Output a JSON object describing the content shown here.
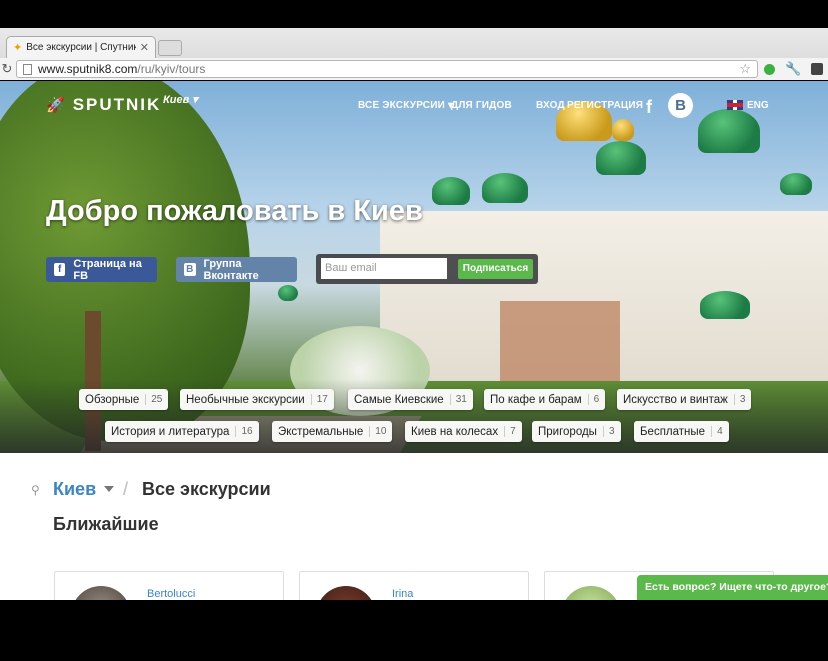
{
  "browser": {
    "tab_title": "Все экскурсии | Спутник",
    "url_host": "www.sputnik8.com",
    "url_path": "/ru/kyiv/tours"
  },
  "header": {
    "logo": "SPUTNIK",
    "city": "Киев ▾",
    "nav_all_tours": "ВСЕ ЭКСКУРСИИ ▾",
    "nav_for_guides": "ДЛЯ ГИДОВ",
    "nav_login": "ВХОД",
    "nav_register": "РЕГИСТРАЦИЯ",
    "fb_letter": "f",
    "vk_letter": "B",
    "lang": "ENG"
  },
  "hero": {
    "title": "Добро пожаловать в Киев",
    "fb_button": "Страница на FB",
    "vk_button": "Группа Вконтакте",
    "email_placeholder": "Ваш email",
    "subscribe_button": "Подписаться"
  },
  "categories": [
    {
      "label": "Обзорные",
      "count": "25"
    },
    {
      "label": "Необычные экскурсии",
      "count": "17"
    },
    {
      "label": "Самые Киевские",
      "count": "31"
    },
    {
      "label": "По кафе и барам",
      "count": "6"
    },
    {
      "label": "Искусство и винтаж",
      "count": "3"
    },
    {
      "label": "История и литература",
      "count": "16"
    },
    {
      "label": "Экстремальные",
      "count": "10"
    },
    {
      "label": "Киев на колесах",
      "count": "7"
    },
    {
      "label": "Пригороды",
      "count": "3"
    },
    {
      "label": "Бесплатные",
      "count": "4"
    }
  ],
  "breadcrumb": {
    "city": "Киев",
    "separator": "/",
    "current": "Все экскурсии"
  },
  "section": {
    "title": "Ближайшие"
  },
  "cards": [
    {
      "guide": "Bertolucci"
    },
    {
      "guide": "Irina"
    },
    {
      "guide": ""
    }
  ],
  "help_tab": "Есть вопрос? Ищете что-то другое?"
}
